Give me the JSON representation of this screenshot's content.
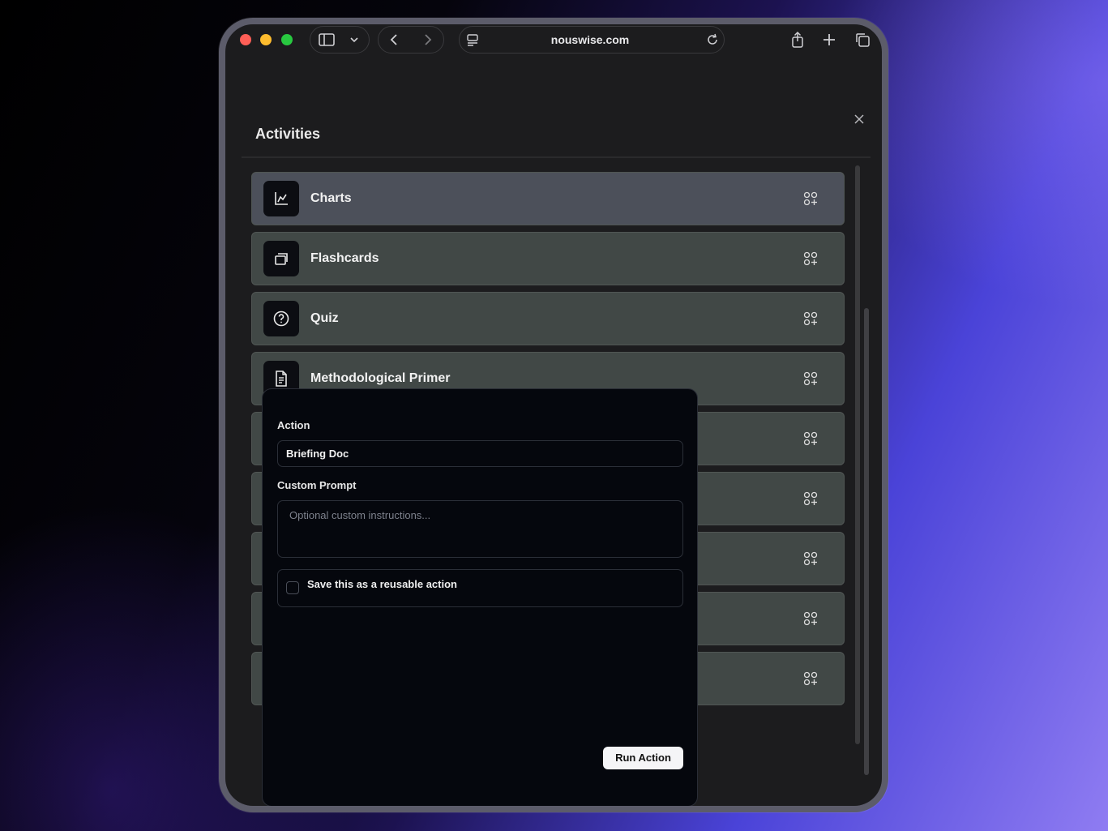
{
  "browser": {
    "url": "nouswise.com",
    "traffic_lights": [
      "#ff5f57",
      "#febc2e",
      "#28c840"
    ]
  },
  "modal": {
    "title": "Activities",
    "items": [
      {
        "label": "Charts",
        "icon": "chart-icon"
      },
      {
        "label": "Flashcards",
        "icon": "cards-icon"
      },
      {
        "label": "Quiz",
        "icon": "question-icon"
      },
      {
        "label": "Methodological Primer",
        "icon": "document-icon"
      },
      {
        "label": "",
        "icon": ""
      },
      {
        "label": "",
        "icon": ""
      },
      {
        "label": "",
        "icon": ""
      },
      {
        "label": "",
        "icon": ""
      },
      {
        "label": "",
        "icon": ""
      }
    ]
  },
  "action_panel": {
    "action_label": "Action",
    "action_value": "Briefing Doc",
    "prompt_label": "Custom Prompt",
    "prompt_placeholder": "Optional custom instructions...",
    "save_label": "Save this as a reusable action",
    "save_checked": false,
    "run_button": "Run Action"
  }
}
